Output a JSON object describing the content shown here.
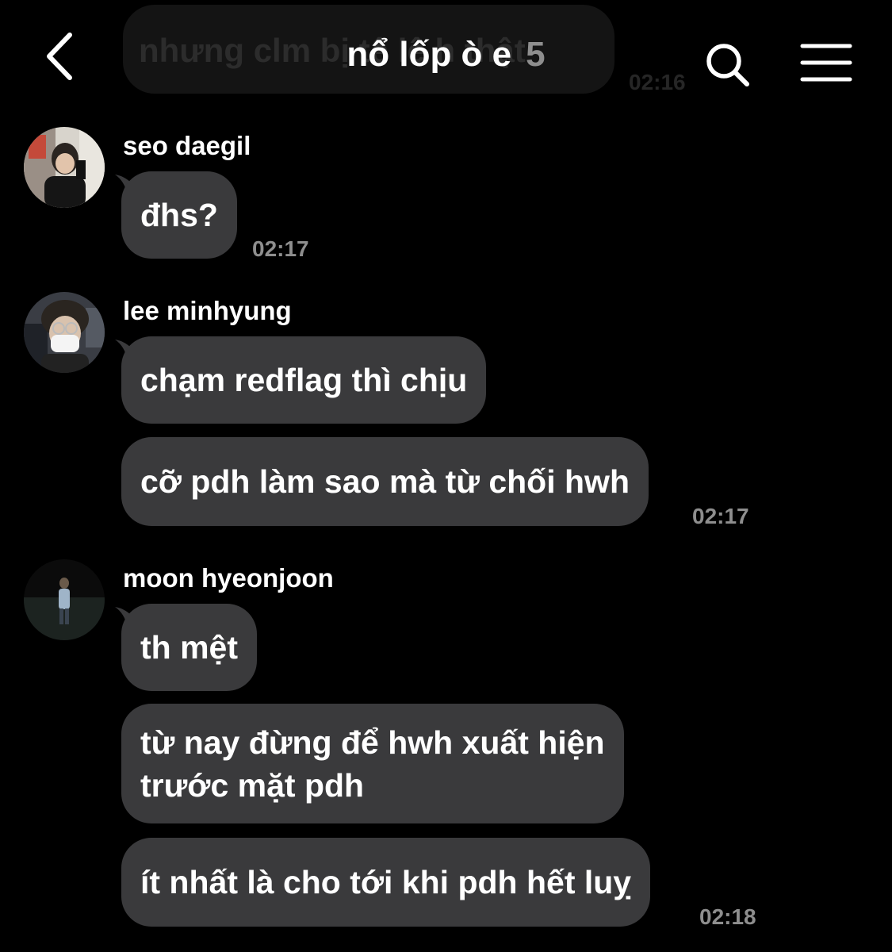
{
  "header": {
    "title": "nổ lốp ò e",
    "member_count": "5",
    "back_icon": "chevron-left-icon",
    "search_icon": "search-icon",
    "menu_icon": "hamburger-menu-icon"
  },
  "ghost": {
    "text": "nhưng clm bị tê lê h thật",
    "time": "02:16"
  },
  "groups": [
    {
      "sender": "seo daegil",
      "messages": [
        "đhs?"
      ],
      "time": "02:17"
    },
    {
      "sender": "lee minhyung",
      "messages": [
        "chạm redflag thì chịu",
        "cỡ pdh làm sao mà từ chối hwh"
      ],
      "time": "02:17"
    },
    {
      "sender": "moon hyeonjoon",
      "messages": [
        "th mệt",
        "từ nay đừng để hwh xuất hiện",
        "trước mặt pdh",
        "ít nhất là cho tới khi pdh hết luỵ"
      ],
      "time": "02:18"
    }
  ],
  "colors": {
    "background": "#000000",
    "bubble": "#3a3a3c",
    "muted_text": "#8e8e8e"
  }
}
